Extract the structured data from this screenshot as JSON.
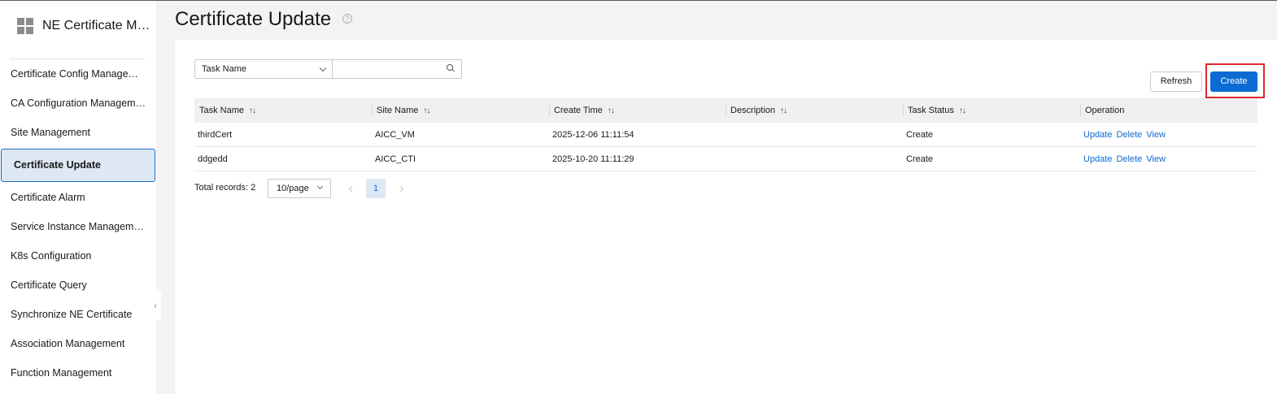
{
  "app": {
    "title": "NE Certificate Management"
  },
  "sidebar": {
    "items": [
      {
        "label": "Certificate Config Management",
        "active": false
      },
      {
        "label": "CA Configuration Management",
        "active": false
      },
      {
        "label": "Site Management",
        "active": false
      },
      {
        "label": "Certificate Update",
        "active": true
      },
      {
        "label": "Certificate Alarm",
        "active": false
      },
      {
        "label": "Service Instance Management",
        "active": false
      },
      {
        "label": "K8s Configuration",
        "active": false
      },
      {
        "label": "Certificate Query",
        "active": false
      },
      {
        "label": "Synchronize NE Certificate",
        "active": false
      },
      {
        "label": "Association Management",
        "active": false
      },
      {
        "label": "Function Management",
        "active": false
      }
    ]
  },
  "page": {
    "title": "Certificate Update"
  },
  "filter": {
    "field": "Task Name",
    "value": "",
    "placeholder": ""
  },
  "toolbar": {
    "refresh_label": "Refresh",
    "create_label": "Create"
  },
  "table": {
    "columns": [
      "Task Name",
      "Site Name",
      "Create Time",
      "Description",
      "Task Status",
      "Operation"
    ],
    "rows": [
      {
        "task_name": "thirdCert",
        "site_name": "AICC_VM",
        "create_time": "2025-12-06 11:11:54",
        "description": "",
        "task_status": "Create",
        "actions": [
          "Update",
          "Delete",
          "View"
        ]
      },
      {
        "task_name": "ddgedd",
        "site_name": "AICC_CTI",
        "create_time": "2025-10-20 11:11:29",
        "description": "",
        "task_status": "Create",
        "actions": [
          "Update",
          "Delete",
          "View"
        ]
      }
    ]
  },
  "pagination": {
    "total_text": "Total records: 2",
    "page_size": "10/page",
    "current_page": "1"
  },
  "colors": {
    "accent": "#0b6bd3",
    "highlight": "#e0282e",
    "active_bg": "#dde8f4"
  }
}
